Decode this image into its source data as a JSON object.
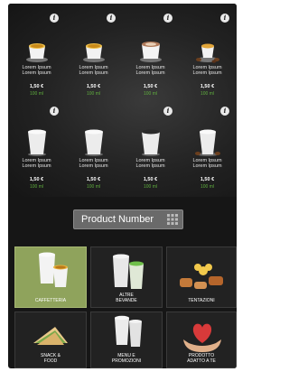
{
  "colors": {
    "screen_bg": "#161616",
    "selected_category": "#8fa35c",
    "volume_text": "#5fae3e",
    "product_number_button": "#6a6a6a"
  },
  "products": [
    {
      "name_line1": "Lorem Ipsum",
      "name_line2": "Lorem Ipsum",
      "price": "1,50 €",
      "volume": "100 ml",
      "icon": "espresso-cup-icon"
    },
    {
      "name_line1": "Lorem Ipsum",
      "name_line2": "Lorem Ipsum",
      "price": "1,50 €",
      "volume": "100 ml",
      "icon": "espresso-cup-icon"
    },
    {
      "name_line1": "Lorem Ipsum",
      "name_line2": "Lorem Ipsum",
      "price": "1,50 €",
      "volume": "100 ml",
      "icon": "cappuccino-cup-icon"
    },
    {
      "name_line1": "Lorem Ipsum",
      "name_line2": "Lorem Ipsum",
      "price": "1,50 €",
      "volume": "100 ml",
      "icon": "espresso-with-beans-icon"
    },
    {
      "name_line1": "Lorem Ipsum",
      "name_line2": "Lorem Ipsum",
      "price": "1,50 €",
      "volume": "100 ml",
      "icon": "paper-cup-icon"
    },
    {
      "name_line1": "Lorem Ipsum",
      "name_line2": "Lorem Ipsum",
      "price": "1,50 €",
      "volume": "100 ml",
      "icon": "paper-cup-icon"
    },
    {
      "name_line1": "Lorem Ipsum",
      "name_line2": "Lorem Ipsum",
      "price": "1,50 €",
      "volume": "100 ml",
      "icon": "paper-cup-dark-icon"
    },
    {
      "name_line1": "Lorem Ipsum",
      "name_line2": "Lorem Ipsum",
      "price": "1,50 €",
      "volume": "100 ml",
      "icon": "paper-cup-with-beans-icon"
    }
  ],
  "info_badge_label": "i",
  "product_number": {
    "label": "Product Number",
    "icon": "keypad-icon"
  },
  "categories": [
    {
      "label_line1": "CAFFETTERIA",
      "label_line2": "",
      "icon": "coffee-cups-icon",
      "selected": true
    },
    {
      "label_line1": "ALTRE",
      "label_line2": "BEVANDE",
      "icon": "drink-cups-icon",
      "selected": false
    },
    {
      "label_line1": "TENTAZIONI",
      "label_line2": "",
      "icon": "pastries-icon",
      "selected": false
    },
    {
      "label_line1": "SNACK &",
      "label_line2": "FOOD",
      "icon": "sandwich-icon",
      "selected": false
    },
    {
      "label_line1": "MENU E",
      "label_line2": "PROMOZIONI",
      "icon": "menu-cups-icon",
      "selected": false
    },
    {
      "label_line1": "PRODOTTO",
      "label_line2": "ADATTO A TE",
      "icon": "heart-hands-icon",
      "selected": false
    }
  ]
}
